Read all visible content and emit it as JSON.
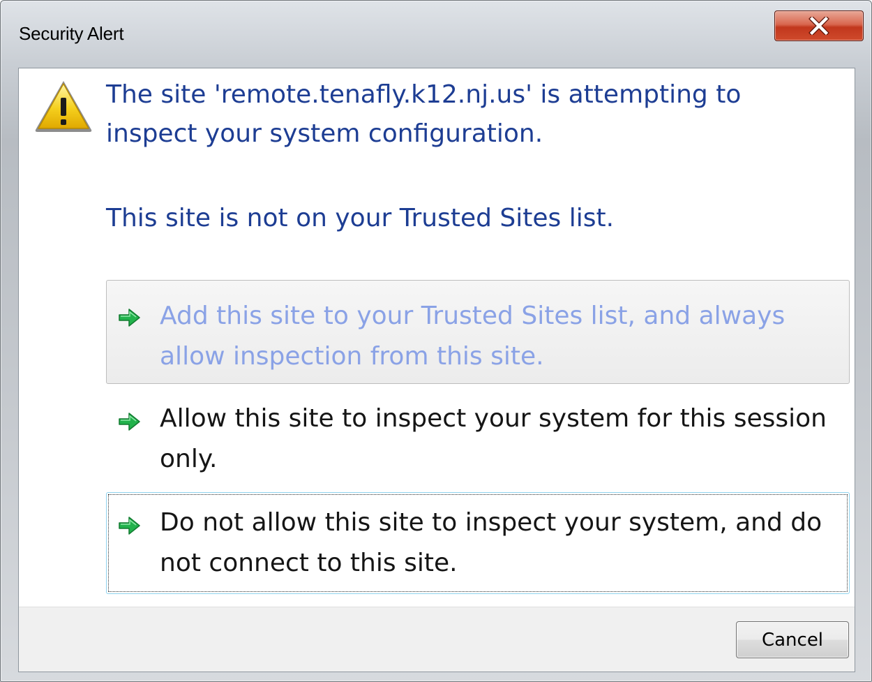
{
  "window": {
    "title": "Security Alert",
    "close_label": "X"
  },
  "icons": {
    "warning": "warning-triangle-icon",
    "command_arrow": "green-arrow-icon",
    "close": "close-icon"
  },
  "colors": {
    "instruction_text": "#1d3d93",
    "disabled_command_text": "#8aa2e6",
    "command_text": "#151515",
    "arrow_green": "#22b24c",
    "close_red": "#c2371d"
  },
  "content": {
    "main_instruction": "The site 'remote.tenafly.k12.nj.us' is attempting to inspect your system configuration.",
    "secondary_text": "This site is not on your Trusted Sites list."
  },
  "commands": [
    {
      "label": "Add this site to your Trusted Sites list, and always allow inspection from this site.",
      "state": "hover"
    },
    {
      "label": "Allow this site to inspect your system for this session only.",
      "state": "normal"
    },
    {
      "label": "Do not allow this site to inspect your system, and do not connect to this site.",
      "state": "focused"
    }
  ],
  "footer": {
    "cancel_label": "Cancel"
  }
}
